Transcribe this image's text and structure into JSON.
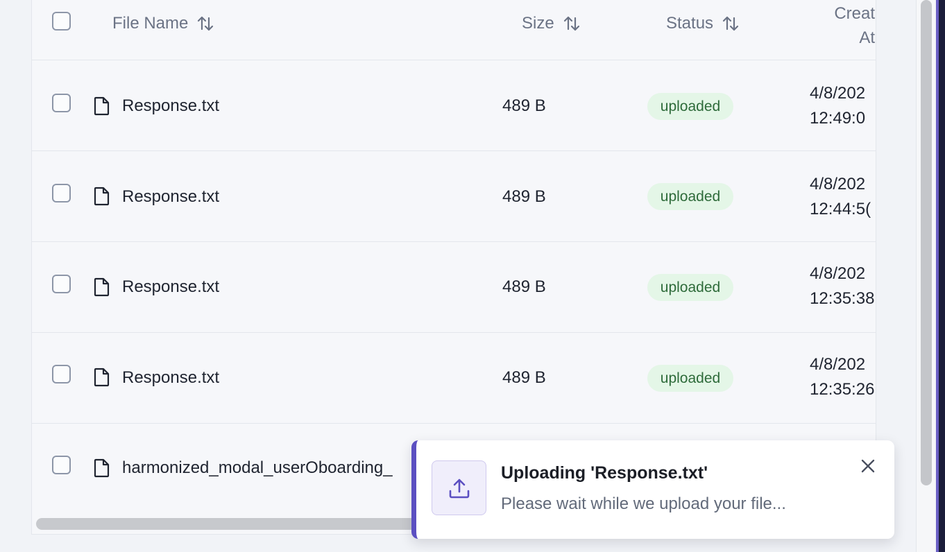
{
  "table": {
    "columns": [
      {
        "label": "File Name"
      },
      {
        "label": "Size"
      },
      {
        "label": "Status"
      },
      {
        "label": "Creat\nAt"
      }
    ],
    "rows": [
      {
        "name": "Response.txt",
        "size": "489 B",
        "status": "uploaded",
        "created": "4/8/202\n12:49:0"
      },
      {
        "name": "Response.txt",
        "size": "489 B",
        "status": "uploaded",
        "created": "4/8/202\n12:44:5("
      },
      {
        "name": "Response.txt",
        "size": "489 B",
        "status": "uploaded",
        "created": "4/8/202\n12:35:38"
      },
      {
        "name": "Response.txt",
        "size": "489 B",
        "status": "uploaded",
        "created": "4/8/202\n12:35:26"
      },
      {
        "name": "harmonized_modal_userOboarding_",
        "size": "",
        "status": "",
        "created": ""
      }
    ]
  },
  "toast": {
    "title": "Uploading 'Response.txt'",
    "message": "Please wait while we upload your file...",
    "icon": "upload-icon",
    "accent": "#5b4fc1"
  },
  "colors": {
    "badge_bg": "#e4f6e7",
    "badge_text": "#2e6b3a"
  }
}
